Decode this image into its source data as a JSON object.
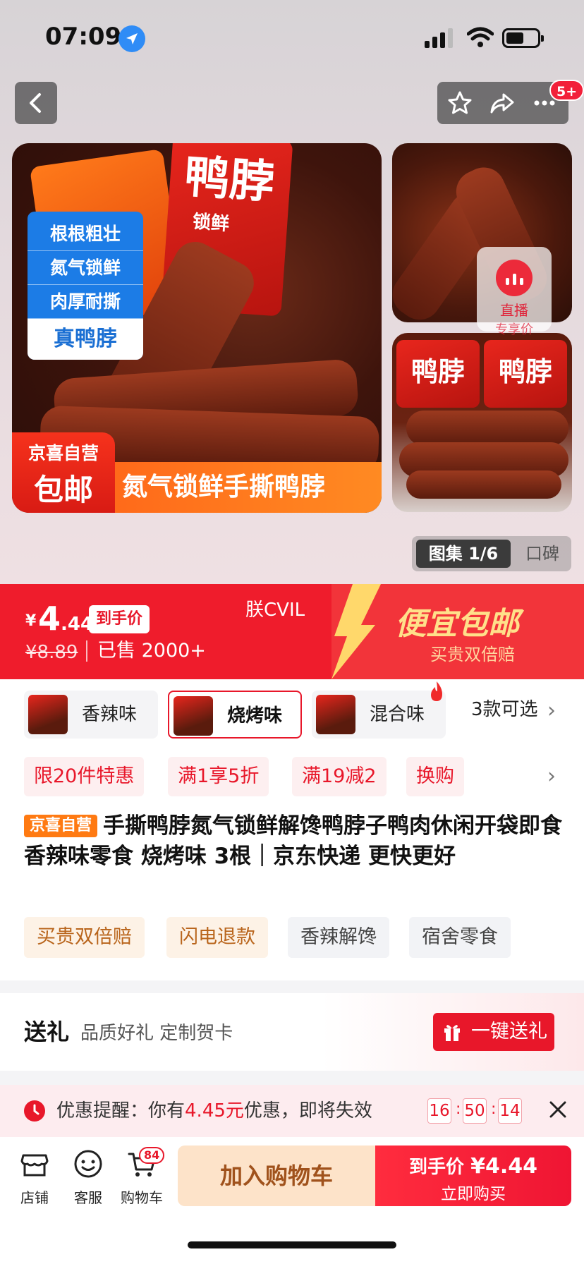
{
  "status": {
    "time": "07:09"
  },
  "header": {
    "cart_badge": "5+"
  },
  "gallery": {
    "main_bullets": [
      "根根粗壮",
      "氮气锁鲜",
      "肉厚耐撕"
    ],
    "main_bullet_highlight": "真鸭脖",
    "self_tag_line1": "京喜自营",
    "self_tag_line2": "包邮",
    "strip_text": "氮气锁鲜手撕鸭脖",
    "pack_text": "鸭脖",
    "pack_subtext": "锁鲜",
    "live_label": "直播",
    "live_sub": "专享价",
    "counter": "图集 1/6",
    "reviews_tab": "口碑"
  },
  "price": {
    "currency": "¥",
    "integer": "4",
    "decimal": ".44",
    "final_price_tag": "到手价",
    "original": "¥8.89",
    "sold": "已售 2000+",
    "overlay_text": "朕CVIL",
    "promo_title": "便宜包邮",
    "promo_sub": "买贵双倍赔"
  },
  "variants": {
    "items": [
      "香辣味",
      "烧烤味",
      "混合味"
    ],
    "selected": "烧烤味",
    "more": "3款可选"
  },
  "promos": [
    "限20件特惠",
    "满1享5折",
    "满19减2",
    "换购"
  ],
  "product": {
    "badge": "京喜自营",
    "title": "手撕鸭脖氮气锁鲜解馋鸭脖子鸭肉休闲开袋即食香辣味零食 烧烤味 3根｜京东快递 更快更好"
  },
  "chips": [
    "买贵双倍赔",
    "闪电退款",
    "香辣解馋",
    "宿舍零食"
  ],
  "gift": {
    "title": "送礼",
    "subtitle": "品质好礼 定制贺卡",
    "button": "一键送礼"
  },
  "notice": {
    "prefix": "优惠提醒：你有",
    "amount": "4.45元",
    "suffix": "优惠，即将失效",
    "countdown": [
      "16",
      "50",
      "14"
    ]
  },
  "bottom": {
    "store": "店铺",
    "service": "客服",
    "cart": "购物车",
    "cart_count": "84",
    "add_to_cart": "加入购物车",
    "buy_label": "到手价",
    "buy_price": "¥4.44",
    "buy_action": "立即购买"
  },
  "colors": {
    "brand_red": "#e8172a",
    "accent_orange": "#ff7a12",
    "blue_tag": "#1c7ce6"
  }
}
